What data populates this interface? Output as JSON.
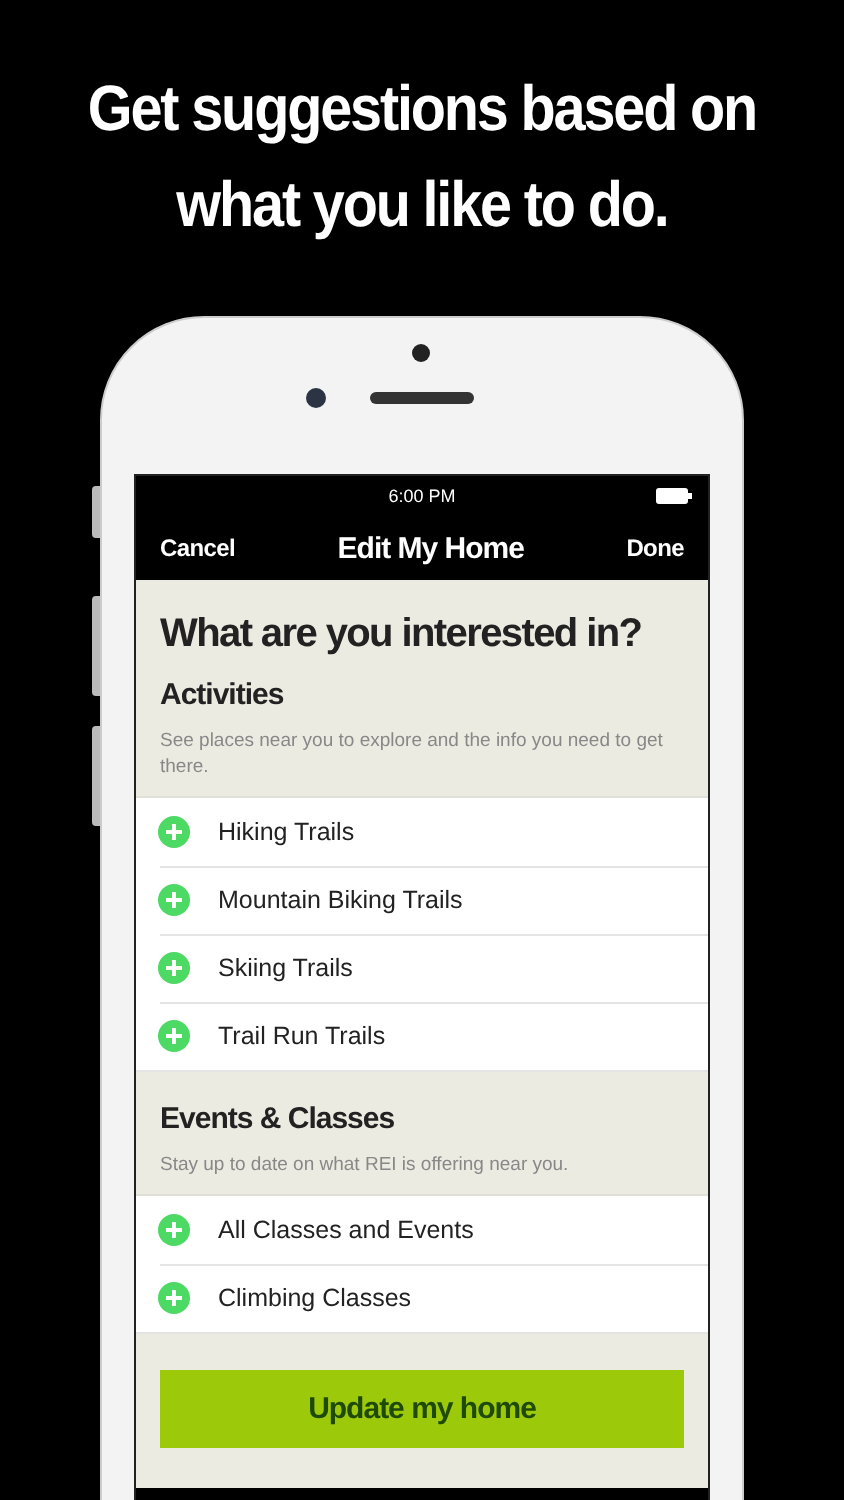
{
  "headline": "Get suggestions based on what you like to do.",
  "status_bar": {
    "time": "6:00 PM"
  },
  "nav": {
    "cancel": "Cancel",
    "title": "Edit My Home",
    "done": "Done"
  },
  "page_title": "What are you interested in?",
  "sections": [
    {
      "title": "Activities",
      "description": "See places near you to explore and the info you need to get there.",
      "items": [
        {
          "label": "Hiking Trails"
        },
        {
          "label": "Mountain Biking Trails"
        },
        {
          "label": "Skiing Trails"
        },
        {
          "label": "Trail Run Trails"
        }
      ]
    },
    {
      "title": "Events & Classes",
      "description": "Stay up to date on what REI is offering near you.",
      "items": [
        {
          "label": "All Classes and Events"
        },
        {
          "label": "Climbing Classes"
        }
      ]
    }
  ],
  "update_button": "Update my home"
}
